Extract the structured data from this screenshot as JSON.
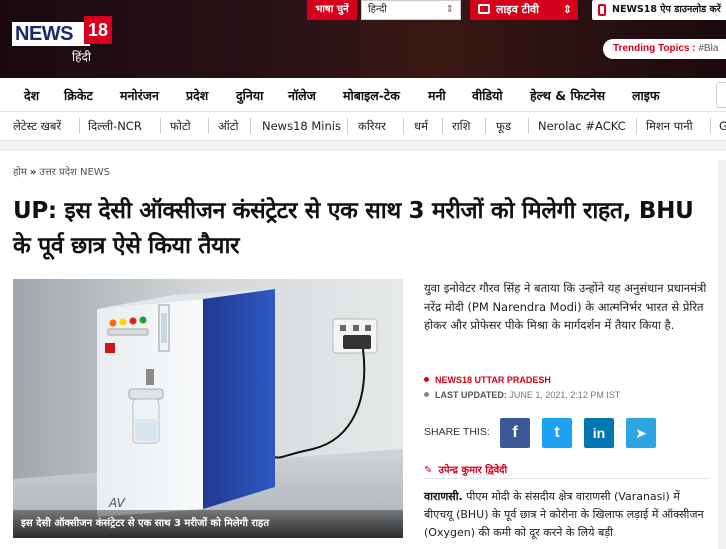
{
  "header": {
    "logo_text": "NEWS",
    "logo_number": "18",
    "logo_sub": "हिंदी",
    "language_label": "भाषा चुनें",
    "language_value": "हिन्दी",
    "live_tv_label": "लाइव टीवी",
    "app_download_label": "NEWS18 ऐप डाउनलोड करें",
    "trending_label": "Trending Topics :",
    "trending_value": "#Bla"
  },
  "nav_primary": [
    "देश",
    "क्रिकेट",
    "मनोरंजन",
    "प्रदेश",
    "दुनिया",
    "नॉलेज",
    "मोबाइल-टेक",
    "मनी",
    "वीडियो",
    "हेल्थ & फिटनेस",
    "लाइफ"
  ],
  "nav_secondary": [
    "लेटेस्ट खबरें",
    "दिल्ली-NCR",
    "फोटो",
    "ऑटो",
    "News18 Minis",
    "करियर",
    "धर्म",
    "राशि",
    "फूड",
    "Nerolac #ACKC",
    "मिशन पानी",
    "G"
  ],
  "breadcrumb": {
    "home": "होम",
    "separator": "»",
    "section": "उत्तर प्रदेश NEWS"
  },
  "article": {
    "headline": "UP: इस देसी ऑक्सीजन कंसंट्रेटर से एक साथ 3 मरीजों को मिलेगी राहत, BHU के पूर्व छात्र ऐसे किया तैयार",
    "image_caption": "इस देसी ऑक्सीजन कंसंट्रेटर से एक साथ 3 मरीजों को मिलेगी राहत",
    "image_brand": "AV",
    "summary": "युवा इनोवेटर गौरव सिंह ने बताया कि उन्होंने यह अनुसंधान प्रधानमंत्री नरेंद्र मोदी (PM Narendra Modi) के आत्मनिर्भर भारत से प्रेरित होकर और प्रोफेसर पीके मिश्रा के मार्गदर्शन में तैयार किया है.",
    "source": "NEWS18 UTTAR PRADESH",
    "updated_label": "LAST UPDATED:",
    "updated_value": "JUNE 1, 2021, 2:12 PM IST",
    "share_label": "SHARE THIS:",
    "author": "उपेन्द्र कुमार द्विवेदी",
    "body_lead": "वाराणसी.",
    "body_text": " पीएम मोदी के संसदीय क्षेत्र वाराणसी (Varanasi) में बीएचयू (BHU) के पूर्व छात्र ने कोरोना के खिलाफ लड़ाई में ऑक्सीजन (Oxygen) की कमी को दूर करने के लिये बड़ी"
  },
  "share_buttons": [
    {
      "name": "facebook",
      "glyph": "f",
      "color": "#3b5998"
    },
    {
      "name": "twitter",
      "glyph": "t",
      "color": "#1da1f2"
    },
    {
      "name": "linkedin",
      "glyph": "in",
      "color": "#0077b5"
    },
    {
      "name": "telegram",
      "glyph": "➤",
      "color": "#2ca5e0"
    }
  ],
  "colors": {
    "brand_red": "#d6001c",
    "header_dark": "#1a0a10"
  }
}
